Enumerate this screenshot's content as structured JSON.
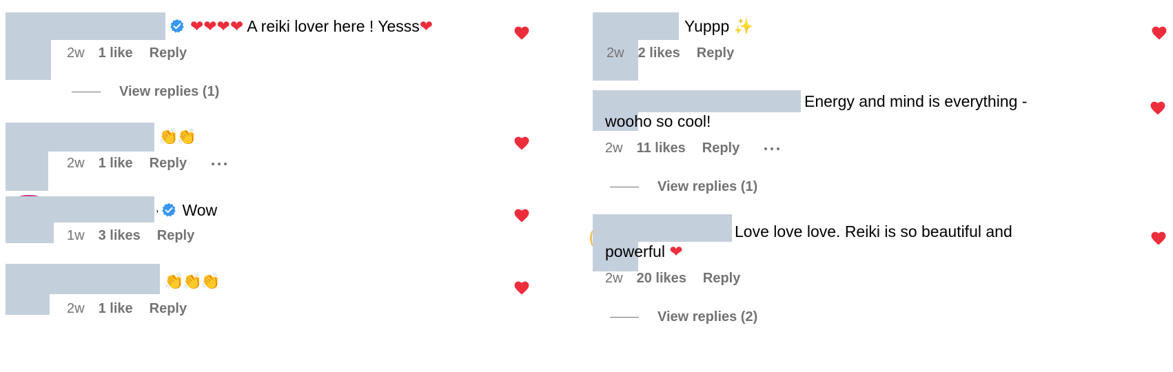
{
  "colors": {
    "heart": "#ed2d3c",
    "meta": "#737373",
    "redaction": "#c4cfdc",
    "verified": "#3897f0"
  },
  "comments": [
    {
      "text": "A reiki lover here ! Yesss",
      "leading_emoji": "❤❤❤❤",
      "trailing_emoji": "❤",
      "verified": true,
      "time": "2w",
      "likes": "1 like",
      "reply": "Reply",
      "view_replies": "View replies (1)",
      "like_icon": "heart-icon"
    },
    {
      "text": "",
      "emoji": "👏👏",
      "time": "2w",
      "likes": "1 like",
      "reply": "Reply",
      "more_icon": "more-options-icon",
      "like_icon": "heart-icon"
    },
    {
      "text": "Wow",
      "verified": true,
      "time": "1w",
      "likes": "3 likes",
      "reply": "Reply",
      "like_icon": "heart-icon"
    },
    {
      "text": "",
      "emoji": "👏👏👏",
      "time": "2w",
      "likes": "1 like",
      "reply": "Reply",
      "like_icon": "heart-icon"
    },
    {
      "text": "Yuppp",
      "emoji": "✨",
      "time": "2w",
      "likes": "2 likes",
      "reply": "Reply",
      "like_icon": "heart-icon"
    },
    {
      "text_line1": "Energy and mind is everything -",
      "text_line2": "wooho so cool!",
      "time": "2w",
      "likes": "11 likes",
      "reply": "Reply",
      "more_icon": "more-options-icon",
      "view_replies": "View replies (1)",
      "like_icon": "heart-icon"
    },
    {
      "text_line1": "Love love love. Reiki is so beautiful and",
      "text_line2": "powerful",
      "emoji": "❤",
      "time": "2w",
      "likes": "20 likes",
      "reply": "Reply",
      "view_replies": "View replies (2)",
      "like_icon": "heart-icon"
    }
  ]
}
